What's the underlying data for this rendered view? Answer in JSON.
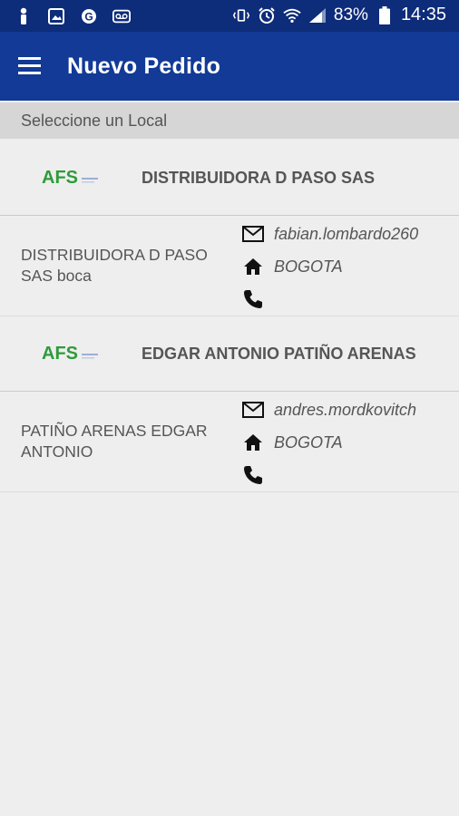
{
  "status_bar": {
    "battery": "83%",
    "time": "14:35",
    "left_icons": [
      "person-icon",
      "image-icon",
      "g-icon",
      "voicemail-icon"
    ],
    "right_icons": [
      "vibrate-icon",
      "alarm-icon",
      "wifi-icon",
      "signal-icon",
      "battery-icon"
    ]
  },
  "app_bar": {
    "title": "Nuevo Pedido",
    "menu_icon": "menu-icon"
  },
  "subheader": {
    "label": "Seleccione un Local"
  },
  "colors": {
    "status_bar": "#0d2c7a",
    "app_bar": "#123a96",
    "logo_green": "#2e9b3a",
    "logo_blue": "#1b4fb0"
  },
  "stores": [
    {
      "logo_text": "AFS",
      "name": "DISTRIBUIDORA D PASO SAS",
      "local_name": "DISTRIBUIDORA D PASO SAS boca",
      "email": "fabian.lombardo260",
      "city": "BOGOTA",
      "phone": ""
    },
    {
      "logo_text": "AFS",
      "name": "EDGAR ANTONIO PATIÑO ARENAS",
      "local_name": "PATIÑO ARENAS EDGAR ANTONIO",
      "email": "andres.mordkovitch",
      "city": "BOGOTA",
      "phone": ""
    }
  ]
}
